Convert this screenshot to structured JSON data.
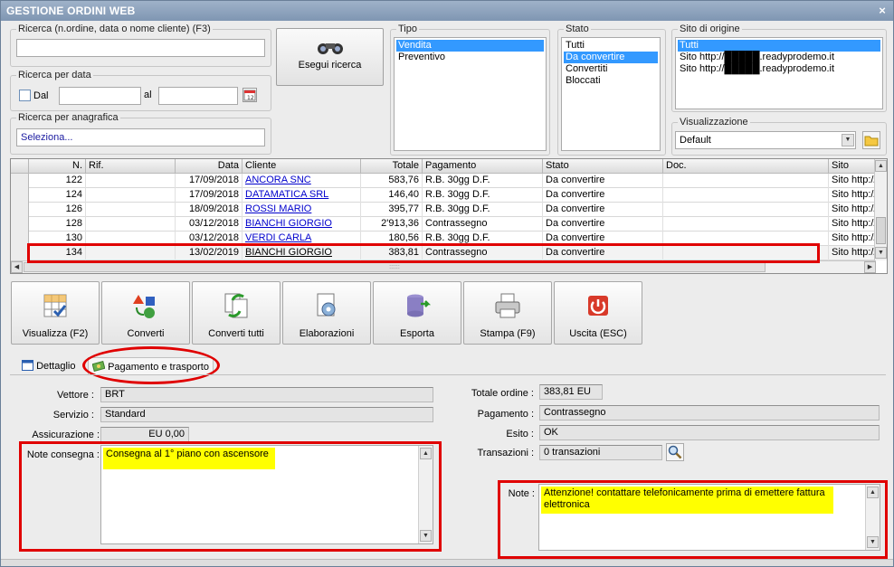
{
  "window": {
    "title": "GESTIONE ORDINI WEB",
    "close_glyph": "×"
  },
  "search": {
    "group_title": "Ricerca (n.ordine, data o nome cliente) (F3)",
    "value": "",
    "date_group_title": "Ricerca per data",
    "dal_label": "Dal",
    "al_label": "al",
    "date_from": "",
    "date_to": "",
    "anagrafica_group_title": "Ricerca per anagrafica",
    "anagrafica_value": "Seleziona...",
    "run_button": "Esegui ricerca"
  },
  "tipo": {
    "title": "Tipo",
    "items": [
      "Vendita",
      "Preventivo"
    ],
    "selected": 0
  },
  "stato": {
    "title": "Stato",
    "items": [
      "Tutti",
      "Da convertire",
      "Convertiti",
      "Bloccati"
    ],
    "selected": 1
  },
  "sito": {
    "title": "Sito di origine",
    "items": [
      "Tutti",
      "Sito http://█████.readyprodemo.it",
      "Sito http://█████.readyprodemo.it"
    ],
    "selected": 0
  },
  "visualizzazione": {
    "title": "Visualizzazione",
    "value": "Default"
  },
  "grid": {
    "columns": [
      "N.",
      "Rif.",
      "Data",
      "Cliente",
      "Totale",
      "Pagamento",
      "Stato",
      "Doc.",
      "Sito"
    ],
    "rows": [
      {
        "n": "122",
        "rif": "",
        "data": "17/09/2018",
        "cliente": "ANCORA SNC",
        "totale": "583,76",
        "pagamento": "R.B. 30gg D.F.",
        "stato": "Da convertire",
        "doc": "",
        "sito": "Sito http://"
      },
      {
        "n": "124",
        "rif": "",
        "data": "17/09/2018",
        "cliente": "DATAMATICA SRL",
        "totale": "146,40",
        "pagamento": "R.B. 30gg D.F.",
        "stato": "Da convertire",
        "doc": "",
        "sito": "Sito http://"
      },
      {
        "n": "126",
        "rif": "",
        "data": "18/09/2018",
        "cliente": "ROSSI MARIO",
        "totale": "395,77",
        "pagamento": "R.B. 30gg D.F.",
        "stato": "Da convertire",
        "doc": "",
        "sito": "Sito http://"
      },
      {
        "n": "128",
        "rif": "",
        "data": "03/12/2018",
        "cliente": "BIANCHI GIORGIO",
        "totale": "2'913,36",
        "pagamento": "Contrassegno",
        "stato": "Da convertire",
        "doc": "",
        "sito": "Sito http://"
      },
      {
        "n": "130",
        "rif": "",
        "data": "03/12/2018",
        "cliente": "VERDI CARLA",
        "totale": "180,56",
        "pagamento": "R.B. 30gg D.F.",
        "stato": "Da convertire",
        "doc": "",
        "sito": "Sito http://"
      },
      {
        "n": "134",
        "rif": "",
        "data": "13/02/2019",
        "cliente": "BIANCHI GIORGIO",
        "totale": "383,81",
        "pagamento": "Contrassegno",
        "stato": "Da convertire",
        "doc": "",
        "sito": "Sito http://"
      }
    ],
    "hscroll_grip": "::::::"
  },
  "toolbar": {
    "visualizza": "Visualizza (F2)",
    "converti": "Converti",
    "converti_tutti": "Converti tutti",
    "elaborazioni": "Elaborazioni",
    "esporta": "Esporta",
    "stampa": "Stampa (F9)",
    "uscita": "Uscita (ESC)"
  },
  "tabs": {
    "dettaglio": "Dettaglio",
    "pagamento_trasporto": "Pagamento e trasporto"
  },
  "detail": {
    "vettore_label": "Vettore :",
    "vettore": "BRT",
    "servizio_label": "Servizio :",
    "servizio": "Standard",
    "assicurazione_label": "Assicurazione :",
    "assicurazione": "EU 0,00",
    "note_consegna_label": "Note consegna :",
    "note_consegna": "Consegna al 1° piano con ascensore",
    "totale_label": "Totale ordine :",
    "totale": "383,81 EU",
    "pagamento_label": "Pagamento :",
    "pagamento": "Contrassegno",
    "esito_label": "Esito :",
    "esito": "OK",
    "transazioni_label": "Transazioni :",
    "transazioni": "0 transazioni",
    "note_label": "Note :",
    "note": "Attenzione! contattare telefonicamente prima di emettere fattura elettronica"
  },
  "colors": {
    "selection": "#3399ff",
    "annotation": "#e00000",
    "highlight": "#ffff00",
    "link": "#0000cc"
  }
}
